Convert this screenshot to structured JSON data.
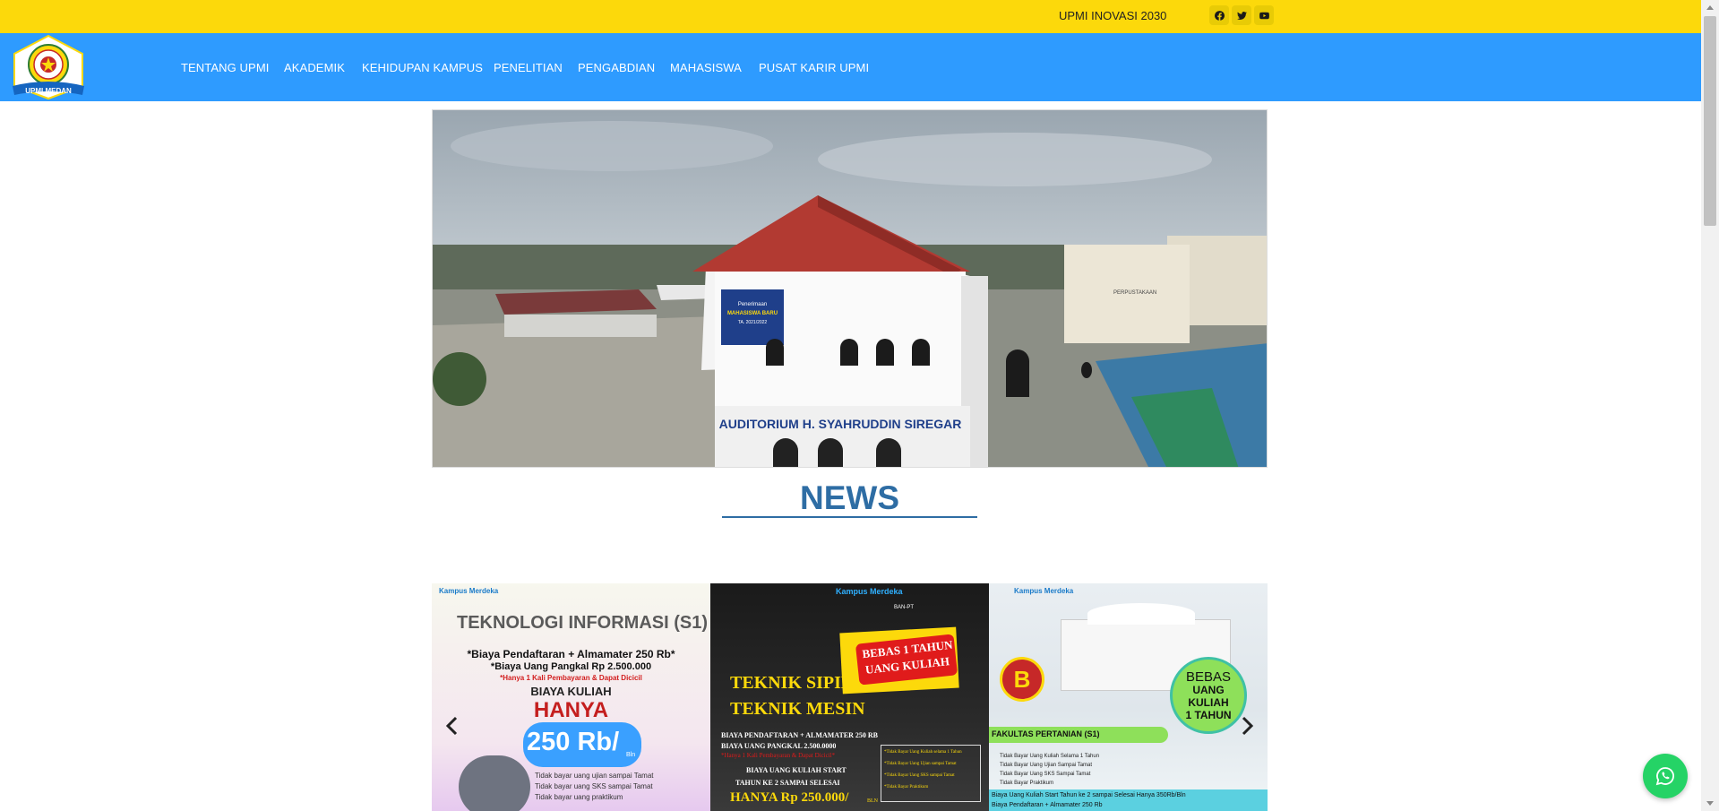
{
  "topbar": {
    "tagline": "UPMI INOVASI 2030",
    "social": [
      "facebook-icon",
      "twitter-icon",
      "youtube-icon"
    ],
    "bg_color": "#fcd90b"
  },
  "logo": {
    "caption": "UPMI MEDAN"
  },
  "nav": {
    "bg_color": "#2e9bff",
    "items": [
      "TENTANG UPMI",
      "AKADEMIK",
      "KEHIDUPAN KAMPUS",
      "PENELITIAN",
      "PENGABDIAN",
      "MAHASISWA",
      "PUSAT KARIR UPMI"
    ]
  },
  "hero": {
    "building_sign": "AUDITORIUM H. SYAHRUDDIN SIREGAR",
    "banner_text": [
      "Penerimaan",
      "MAHASISWA BARU",
      "TA. 2021/2022"
    ],
    "library_sign": "PERPUSTAKAAN"
  },
  "news": {
    "title": "NEWS",
    "slides": [
      {
        "badge": "Kampus Merdeka",
        "heading": "TEKNOLOGI INFORMASI (S1)",
        "line1": "*Biaya Pendaftaran + Almamater 250 Rb*",
        "line2": "*Biaya Uang Pangkal Rp 2.500.000",
        "line3": "*Hanya 1 Kali Pembayaran & Dapat Dicicil",
        "line4": "BIAYA KULIAH",
        "line5": "HANYA",
        "price": "250 Rb/",
        "price_unit": "Bln",
        "bullets": [
          "Tidak bayar uang ujian sampai Tamat",
          "Tidak bayar uang SKS sampai Tamat",
          "Tidak bayar uang praktikum"
        ]
      },
      {
        "badge": "Kampus Merdeka",
        "accreditation": "BAN-PT",
        "ribbon": [
          "BEBAS 1 TAHUN",
          "UANG KULIAH"
        ],
        "heading1": "TEKNIK SIPIL",
        "heading2": "TEKNIK MESIN",
        "line1": "BIAYA PENDAFTARAN + ALMAMATER 250 RB",
        "line2": "BIAYA UANG PANGKAL 2.500.0000",
        "line3": "*Hanya 1 Kali Pembayaran & Dapat Dicicil*",
        "line4": "BIAYA UANG KULIAH START",
        "line5": "TAHUN KE 2 SAMPAI SELESAI",
        "price": "HANYA Rp 250.000/",
        "price_unit": "BLN",
        "bullets": [
          "*Tidak Bayar Uang Kuliah selama 1 Tahun",
          "*Tidak Bayar Uang Ujian sampai Tamat",
          "*Tidak Bayar Uang SKS sampai Tamat",
          "*Tidak Bayar Praktikum"
        ]
      },
      {
        "badge": "Kampus Merdeka",
        "circle": [
          "BEBAS",
          "UANG",
          "KULIAH",
          "1 TAHUN"
        ],
        "seal_letter": "B",
        "faculty": "FAKULTAS PERTANIAN (S1)",
        "bullets": [
          "Tidak Bayar Uang Kuliah Selama 1 Tahun",
          "Tidak Bayar Uang Ujian Sampai Tamat",
          "Tidak Bayar Uang SKS Sampai Tamat",
          "Tidak Bayar Praktikum"
        ],
        "footer1": "Biaya Uang Kuliah Start Tahun ke 2 sampai Selesai Hanya 350Rb/Bln",
        "footer2": "Biaya Pendaftaran + Almamater 250 Rb"
      }
    ]
  },
  "whatsapp": {
    "color": "#25d366"
  }
}
